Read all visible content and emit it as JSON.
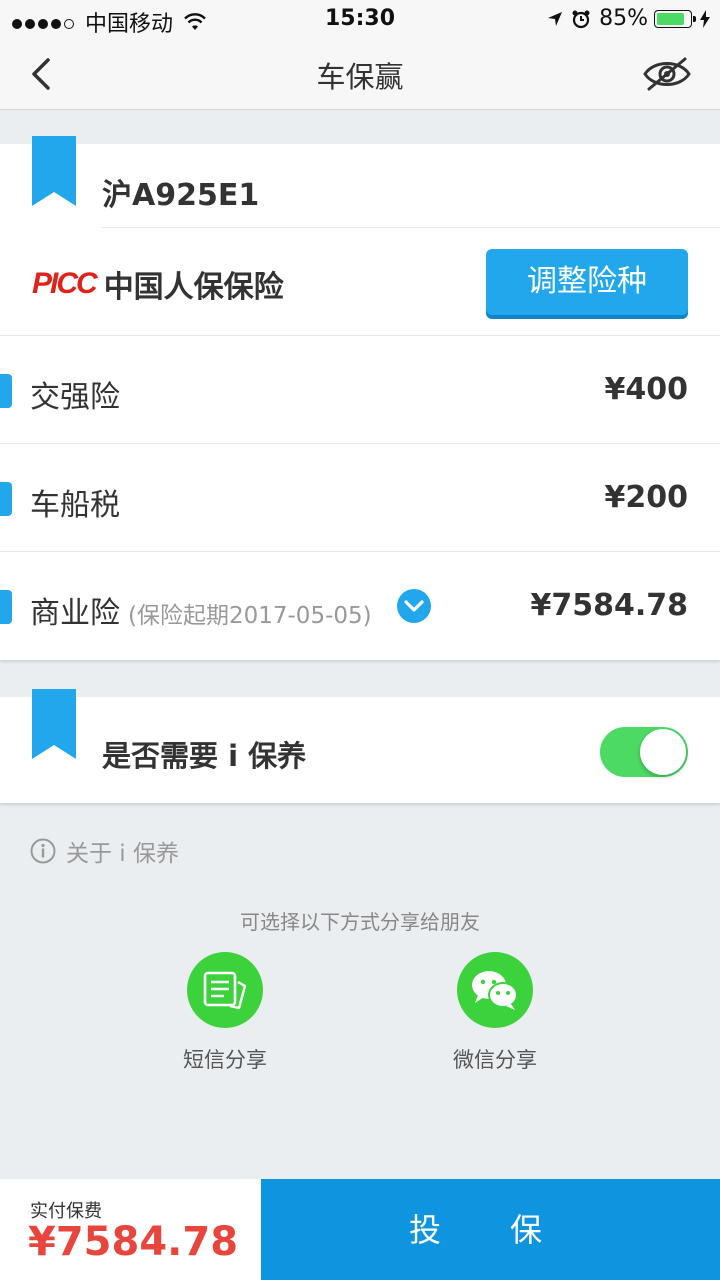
{
  "status_bar": {
    "carrier": "中国移动",
    "time": "15:30",
    "battery": "85%",
    "battery_level": 0.85
  },
  "nav": {
    "title": "车保赢",
    "back_icon": "chevron-left-icon",
    "right_icon": "eye-hidden-icon"
  },
  "vehicle": {
    "plate": "沪A925E1",
    "insurer_logo": "PICC",
    "insurer_name": "中国人保保险",
    "adjust_button": "调整险种"
  },
  "items": [
    {
      "label": "交强险",
      "sub": "",
      "price": "¥400"
    },
    {
      "label": "车船税",
      "sub": "",
      "price": "¥200"
    },
    {
      "label": "商业险",
      "sub": "(保险起期2017-05-05)",
      "price": "¥7584.78"
    }
  ],
  "maintenance": {
    "title": "是否需要 i 保养",
    "enabled": true,
    "about": "关于 i 保养"
  },
  "share": {
    "title": "可选择以下方式分享给朋友",
    "sms": "短信分享",
    "wechat": "微信分享"
  },
  "footer": {
    "paid_label": "实付保费",
    "paid_amount": "¥7584.78",
    "buy_button": "投 保"
  },
  "colors": {
    "accent": "#22a7ec",
    "primary_button": "#0f95e0",
    "toggle_on": "#4cd964",
    "share_green": "#3cd23c",
    "price_red": "#e8453c",
    "picc_red": "#e0231a"
  }
}
